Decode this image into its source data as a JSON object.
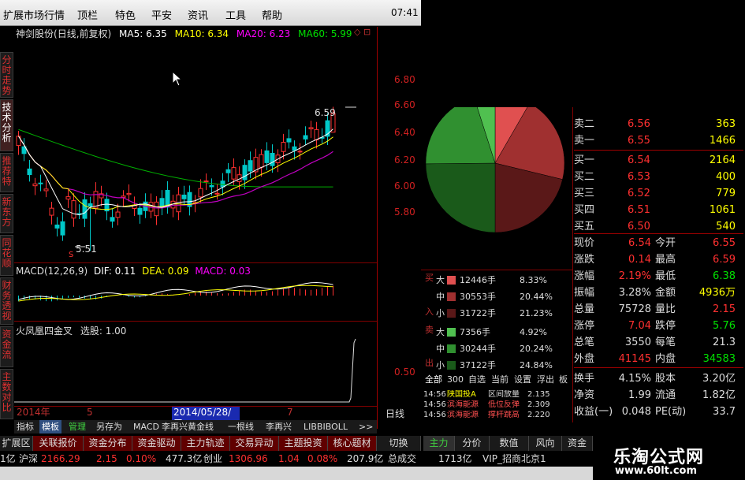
{
  "menubar": {
    "items": [
      "扩展市场行情",
      "顶栏",
      "特色",
      "平安",
      "资讯",
      "工具",
      "帮助"
    ],
    "clock": "07:41"
  },
  "stock": {
    "name": "神剑股份",
    "period_label": "(日线,前复权)",
    "ma5": "MA5: 6.35",
    "ma10": "MA10: 6.34",
    "ma20": "MA20: 6.23",
    "ma60": "MA60: 5.99"
  },
  "left_tabs": [
    "分时走势",
    "技术分析",
    "推荐特",
    "新东方",
    "同花顺",
    "财务透视",
    "资金流",
    "主数对比"
  ],
  "price_axis": [
    "6.80",
    "6.60",
    "6.40",
    "6.20",
    "6.00",
    "5.80"
  ],
  "annotations": {
    "high": "6.59",
    "low": "5.51",
    "marker": "S"
  },
  "macd": {
    "title": "MACD(12,26,9)",
    "dif": "DIF: 0.11",
    "dea": "DEA: 0.09",
    "macd": "MACD: 0.03"
  },
  "indicator": {
    "title": "火凤凰四金叉",
    "select": "选股: 1.00",
    "axis_value": "0.50"
  },
  "date_axis": {
    "year": "2014年",
    "m5": "5",
    "cursor": "2014/05/28/三",
    "m7": "7",
    "period": "日线"
  },
  "indicator_tabs": [
    "指标",
    "模板",
    "管理",
    "另存为",
    "MACD",
    "李再兴黄金线",
    "一根线",
    "李再兴",
    "LIBBIBOLL",
    ">>"
  ],
  "bottom_tabs": [
    "扩展区",
    "关联报价",
    "资金分布",
    "资金驱动",
    "主力轨迹",
    "交易异动",
    "主题投资",
    "核心题材",
    "切换",
    "主力",
    "分价",
    "数值",
    "风向",
    "资金"
  ],
  "order_book": {
    "sell": [
      {
        "label": "卖二",
        "price": "6.56",
        "vol": "363"
      },
      {
        "label": "卖一",
        "price": "6.55",
        "vol": "1466"
      }
    ],
    "buy": [
      {
        "label": "买一",
        "price": "6.54",
        "vol": "2164"
      },
      {
        "label": "买二",
        "price": "6.53",
        "vol": "400"
      },
      {
        "label": "买三",
        "price": "6.52",
        "vol": "779"
      },
      {
        "label": "买四",
        "price": "6.51",
        "vol": "1061"
      },
      {
        "label": "买五",
        "price": "6.50",
        "vol": "540"
      }
    ]
  },
  "quote": [
    {
      "l1": "现价",
      "v1": "6.54",
      "l2": "今开",
      "v2": "6.55"
    },
    {
      "l1": "涨跌",
      "v1": "0.14",
      "l2": "最高",
      "v2": "6.59"
    },
    {
      "l1": "涨幅",
      "v1": "2.19%",
      "l2": "最低",
      "v2": "6.38"
    },
    {
      "l1": "振幅",
      "v1": "3.28%",
      "l2": "金额",
      "v2": "4936万"
    },
    {
      "l1": "总量",
      "v1": "75728",
      "l2": "量比",
      "v2": "2.15"
    },
    {
      "l1": "涨停",
      "v1": "7.04",
      "l2": "跌停",
      "v2": "5.76"
    },
    {
      "l1": "总笔",
      "v1": "3550",
      "l2": "每笔",
      "v2": "21.3"
    },
    {
      "l1": "外盘",
      "v1": "41145",
      "l2": "内盘",
      "v2": "34583"
    },
    {
      "l1": "换手",
      "v1": "4.15%",
      "l2": "股本",
      "v2": "3.20亿"
    },
    {
      "l1": "净资",
      "v1": "1.99",
      "l2": "流通",
      "v2": "1.82亿"
    },
    {
      "l1": "收益(一)",
      "v1": "0.048",
      "l2": "PE(动)",
      "v2": "33.7"
    }
  ],
  "flow": {
    "buy_label": [
      "买",
      "入"
    ],
    "sell_label": [
      "卖",
      "出"
    ],
    "rows": [
      {
        "size": "大",
        "vol": "12446手",
        "pct": "8.33%",
        "color": "#e05050"
      },
      {
        "size": "中",
        "vol": "30553手",
        "pct": "20.44%",
        "color": "#a03030"
      },
      {
        "size": "小",
        "vol": "31722手",
        "pct": "21.23%",
        "color": "#5a1818"
      },
      {
        "size": "大",
        "vol": "7356手",
        "pct": "4.92%",
        "color": "#50c050"
      },
      {
        "size": "中",
        "vol": "30244手",
        "pct": "20.24%",
        "color": "#309030"
      },
      {
        "size": "小",
        "vol": "37122手",
        "pct": "24.84%",
        "color": "#1a5a1a"
      }
    ]
  },
  "flow_tabs": [
    "全部",
    "300",
    "自选",
    "当前",
    "设置",
    "浮出",
    "板"
  ],
  "ticker": [
    {
      "time": "14:56",
      "name": "陕国投A",
      "event": "区间放量",
      "val": "2.135"
    },
    {
      "time": "14:56",
      "name": "滨海能源",
      "event": "低位反弹",
      "val": "2.309"
    },
    {
      "time": "14:56",
      "name": "滨海能源",
      "event": "撑杆跳高",
      "val": "2.220"
    }
  ],
  "statusbar": {
    "amt1": "1亿",
    "sh_label": "沪深",
    "sh_val": "2166.29",
    "sh_chg": "2.15",
    "sh_pct": "0.10%",
    "sh_amt": "477.3亿",
    "cy_label": "创业",
    "cy_val": "1306.96",
    "cy_chg": "1.04",
    "cy_pct": "0.08%",
    "cy_amt": "207.9亿",
    "total_label": "总成交",
    "total_val": "1713亿",
    "vip": "VIP_招商北京1"
  },
  "watermark": {
    "title": "乐淘公式网",
    "url": "www.60lt.com"
  },
  "colors": {
    "up": "#ff3030",
    "down": "#00e000",
    "ma5": "#ffffff",
    "ma10": "#ffff00",
    "ma20": "#ff00ff",
    "ma60": "#00c000",
    "axis": "#a00000"
  }
}
